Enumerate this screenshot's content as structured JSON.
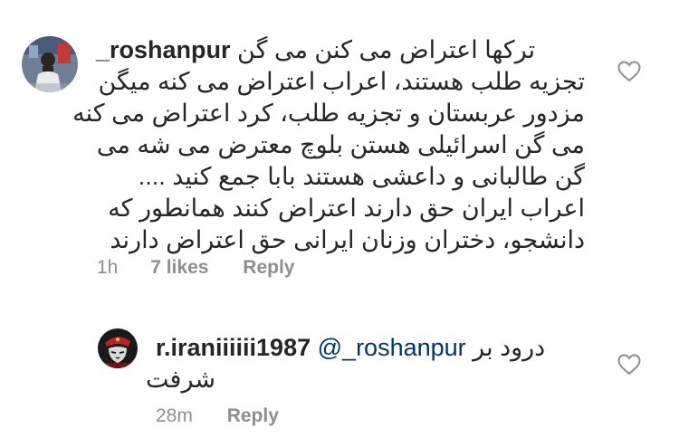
{
  "comments": [
    {
      "username": "_roshanpur",
      "lines": [
        "ترکها اعتراض می کنن می گن",
        "تجزیه طلب هستند، اعراب اعتراض می کنه میگن",
        "مزدور عربستان و تجزیه طلب، کرد اعتراض می کنه",
        "می گن اسرائیلی هستن بلوچ معترض می شه می",
        "گن طالبانی و داعشی هستند بابا جمع کنید ....",
        "اعراب ایران حق دارند اعتراض کنند همانطور که",
        "دانشجو، دختران وزنان ایرانی حق اعتراض دارند"
      ],
      "time": "1h",
      "likes": "7 likes",
      "reply_label": "Reply",
      "avatar_icon": "user-photo-avatar",
      "like_icon": "heart-outline-icon"
    },
    {
      "username": "r.iraniiiiii1987",
      "mention": "@_roshanpur",
      "text_after_mention": "درود بر",
      "text_line2": "شرفت",
      "time": "28m",
      "reply_label": "Reply",
      "avatar_icon": "che-guevara-avatar",
      "like_icon": "heart-outline-icon"
    }
  ],
  "colors": {
    "text": "#262626",
    "meta": "#8e8e8e",
    "mention": "#003569",
    "heart": "#8e8e8e"
  }
}
